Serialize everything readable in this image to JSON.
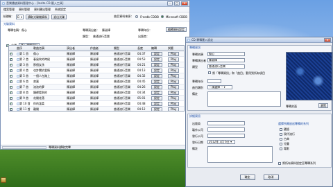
{
  "main_window": {
    "title": "音樂播放資料管理中心 - [Insite CD 匯入工具]",
    "menu": [
      "檔案管理",
      "資料管理",
      "資料匯出管理",
      "系統設定"
    ],
    "toolbar": {
      "drive_label": "光碟機：",
      "drive_value": "E:",
      "btn_fetch": "讀取光碟機資料",
      "btn_eject": "退出光碟",
      "source_label": "曲目資料來源：",
      "source_options": [
        "Freedb CDDB",
        "Microsoft CDDB"
      ],
      "source_selected": "Microsoft CDDB"
    },
    "section_title": "光碟資料",
    "album_info": {
      "album_label": "專輯名稱：",
      "album_value": "傷心",
      "singer_label": "專輯演出者：",
      "singer_value": "陳淑樺",
      "year_label": "專輯年份：",
      "year_value": "",
      "type_label": "類型：",
      "type_value": "普通流行音樂",
      "publisher_label": "出版商：",
      "publisher_value": "",
      "btn_edit": "編輯資料設定"
    },
    "controls": {
      "select_all_label": "全選",
      "select_all_checked": true,
      "btn_import": "匯入選擇資料"
    },
    "table": {
      "columns": [
        "",
        "曲序",
        "歌曲名稱",
        "演出者",
        "作曲者",
        "類型",
        "長度",
        "編輯",
        "試聽"
      ],
      "rows": [
        {
          "checked": true,
          "track": "第 1 首",
          "name": "傷心",
          "artist": "陳淑樺",
          "composer": "陳淑樺",
          "genre": "普通流行音樂",
          "length": "04:37",
          "edit": "設定",
          "play": "Play"
        },
        {
          "checked": true,
          "track": "第 2 首",
          "name": "春風吹的時候",
          "artist": "陳淑樺",
          "composer": "陳淑樺",
          "genre": "普通流行音樂",
          "length": "04:53",
          "edit": "設定",
          "play": "Play"
        },
        {
          "checked": true,
          "track": "第 3 首",
          "name": "那個女孩",
          "artist": "陳淑樺",
          "composer": "陳淑樺",
          "genre": "普通流行音樂",
          "length": "04:21",
          "edit": "設定",
          "play": "Play"
        },
        {
          "checked": true,
          "track": "第 4 首",
          "name": "也許關於愛情",
          "artist": "陳淑樺",
          "composer": "陳淑樺",
          "genre": "普通流行音樂",
          "length": "04:13",
          "edit": "設定",
          "play": "Play"
        },
        {
          "checked": true,
          "track": "第 5 首",
          "name": "一個人在路上",
          "artist": "陳淑樺",
          "composer": "陳淑樺",
          "genre": "普通流行音樂",
          "length": "04:32",
          "edit": "設定",
          "play": "Play"
        },
        {
          "checked": true,
          "track": "第 6 首",
          "name": "寂寞",
          "artist": "陳淑樺",
          "composer": "陳淑樺",
          "genre": "普通流行音樂",
          "length": "04:45",
          "edit": "設定",
          "play": "Play"
        },
        {
          "checked": true,
          "track": "第 7 首",
          "name": "流浪的夢",
          "artist": "陳淑樺",
          "composer": "陳淑樺",
          "genre": "普通流行音樂",
          "length": "04:26",
          "edit": "設定",
          "play": "Play"
        },
        {
          "checked": true,
          "track": "第 8 首",
          "name": "鏡裡看到的",
          "artist": "陳淑樺",
          "composer": "陳淑樺",
          "genre": "普通流行音樂",
          "length": "04:34",
          "edit": "設定",
          "play": "Play"
        },
        {
          "checked": true,
          "track": "第 9 首",
          "name": "花開花落",
          "artist": "陳淑樺",
          "composer": "陳淑樺",
          "genre": "普通流行音樂",
          "length": "05:01",
          "edit": "設定",
          "play": "Play"
        },
        {
          "checked": true,
          "track": "第 10 首",
          "name": "你的溫柔",
          "artist": "陳淑樺",
          "composer": "陳淑樺",
          "genre": "普通流行音樂",
          "length": "04:48",
          "edit": "設定",
          "play": "Play"
        },
        {
          "checked": true,
          "track": "第 11 首",
          "name": "離開",
          "artist": "陳淑樺",
          "composer": "陳淑樺",
          "genre": "普通流行音樂",
          "length": "04:12",
          "edit": "設定",
          "play": "Play"
        },
        {
          "checked": true,
          "track": "第 12 首",
          "name": "Wind Beneath my wings",
          "artist": "陳淑樺",
          "composer": "陳淑樺",
          "genre": "普通流行音樂",
          "length": "04:52",
          "edit": "設定",
          "play": "Play"
        }
      ]
    },
    "status_text": "專輯資料讀取完畢"
  },
  "dialog": {
    "title": "CD 專輯匯入設定",
    "album_section": "專輯資訊",
    "album_name_label": "專輯名稱",
    "album_name_value": "傷心",
    "album_artist_label": "專輯演出者",
    "album_artist_value": "陳淑樺",
    "genre_label": "類型",
    "genre_value": "普通流行音樂",
    "apply_check_label": "將「專輯資訊」和「曲目」套用到所有項目",
    "release_label": "專輯年份",
    "release_value": "",
    "category_label": "曲目類別",
    "category_value": "-- 請選擇 --",
    "remark_label": "備註",
    "cover_label": "專輯封面",
    "cover_btn": "瀏覽",
    "detail_section": "詳細資訊",
    "publisher_label": "出版商",
    "producer_label": "製作公司",
    "company_label": "發行公司",
    "date_label": "發行日期",
    "date_value": "2012年 3月 6日",
    "note_label": "備註",
    "list_title": "選擇所屬放送專輯的系列",
    "list_items": [
      "國語",
      "現代流行",
      "古典",
      "兒童",
      "電影"
    ],
    "bottom_check_label": "將所有資料設定至專輯系列",
    "ok_btn": "確定",
    "cancel_btn": "取消"
  }
}
